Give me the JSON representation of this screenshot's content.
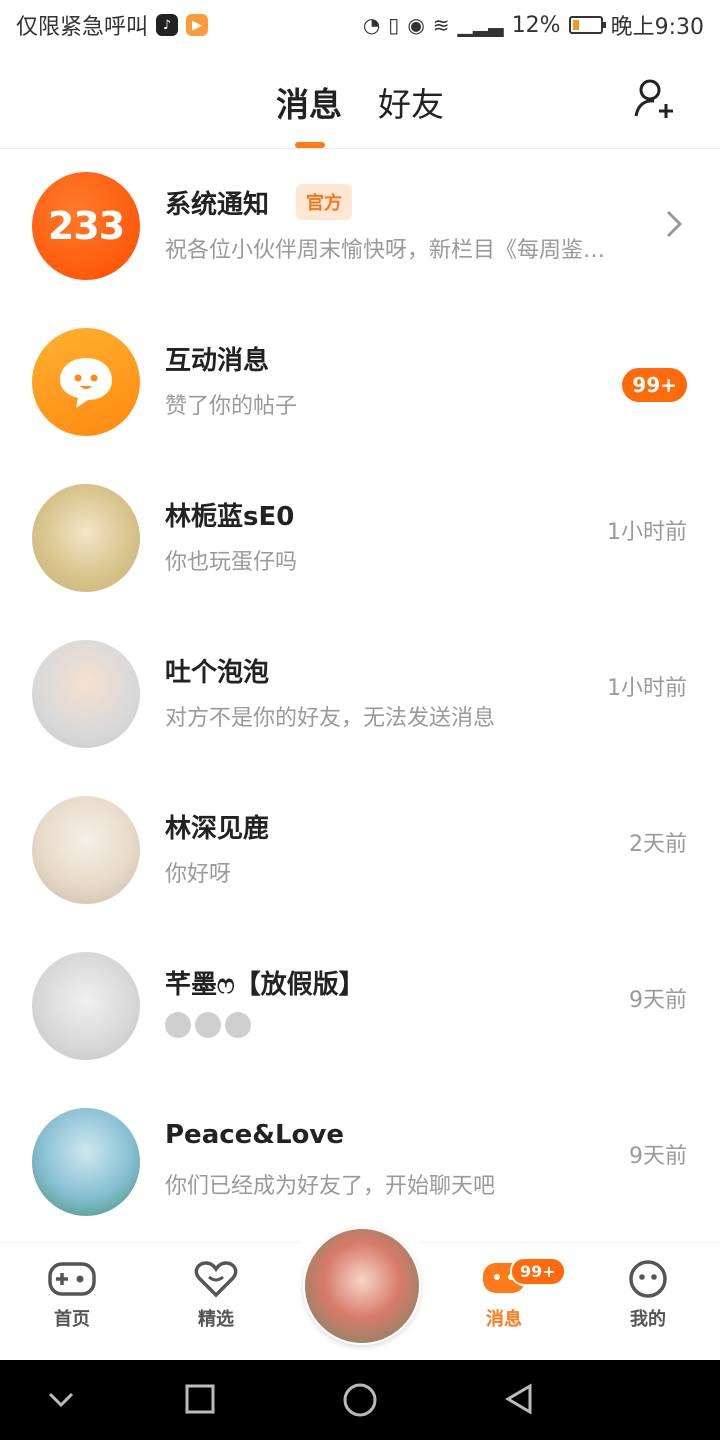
{
  "status_bar": {
    "carrier": "仅限紧急呼叫",
    "battery": "12%",
    "time": "晚上9:30"
  },
  "header": {
    "tabs": [
      {
        "label": "消息",
        "active": true
      },
      {
        "label": "好友",
        "active": false
      }
    ],
    "add_friend_icon": "add-friend-icon"
  },
  "messages": [
    {
      "name": "系统通知",
      "badge": "官方",
      "preview": "祝各位小伙伴周末愉快呀，新栏目《每周鉴…",
      "avatar_text": "233",
      "trailing": "chevron-right"
    },
    {
      "name": "互动消息",
      "preview": "赞了你的帖子",
      "count": "99+"
    },
    {
      "name": "林栀蓝sE0",
      "preview": "你也玩蛋仔吗",
      "time": "1小时前"
    },
    {
      "name": "吐个泡泡",
      "preview": "对方不是你的好友，无法发送消息",
      "time": "1小时前"
    },
    {
      "name": "林深见鹿",
      "preview": "你好呀",
      "time": "2天前"
    },
    {
      "name": "芊墨ෆ【放假版】",
      "preview_emojis": 3,
      "time": "9天前"
    },
    {
      "name": "Peace&Love",
      "preview": "你们已经成为好友了，开始聊天吧",
      "time": "9天前"
    }
  ],
  "bottom_nav": {
    "items": [
      {
        "label": "首页",
        "icon": "gamepad-icon"
      },
      {
        "label": "精选",
        "icon": "heart-icon"
      },
      {
        "label": "消息",
        "icon": "chat-icon",
        "badge": "99+",
        "active": true
      },
      {
        "label": "我的",
        "icon": "face-icon"
      }
    ]
  },
  "colors": {
    "accent": "#ff7a18",
    "badge": "#ff6a0a",
    "muted_text": "#9a9a9a"
  }
}
